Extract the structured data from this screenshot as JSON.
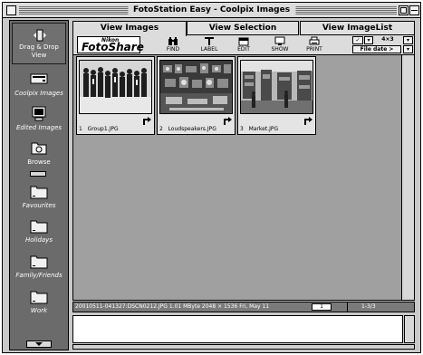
{
  "window": {
    "title": "FotoStation Easy - Coolpix Images"
  },
  "sidebar": {
    "drag_drop_label": "Drag & Drop View",
    "items": [
      {
        "label": "Coolpix Images",
        "icon": "hard-drive-icon"
      },
      {
        "label": "Edited Images",
        "icon": "monitor-icon"
      },
      {
        "label": "Browse",
        "icon": "browse-folder-icon"
      },
      {
        "label": "Favourites",
        "icon": "folder-icon"
      },
      {
        "label": "Holidays",
        "icon": "folder-icon"
      },
      {
        "label": "Family/Friends",
        "icon": "folder-icon"
      },
      {
        "label": "Work",
        "icon": "folder-icon"
      }
    ]
  },
  "tabs": [
    {
      "label": "View Images",
      "active": true
    },
    {
      "label": "View Selection",
      "active": false
    },
    {
      "label": "View ImageList",
      "active": false
    }
  ],
  "toolbar": {
    "logo_small": "Nikon",
    "logo_big": "FotoShare",
    "buttons": [
      {
        "label": "FIND",
        "icon": "binoculars-icon"
      },
      {
        "label": "LABEL",
        "icon": "text-icon"
      },
      {
        "label": "EDIT",
        "icon": "edit-icon"
      },
      {
        "label": "SHOW",
        "icon": "monitor-icon"
      },
      {
        "label": "PRINT",
        "icon": "printer-icon"
      }
    ],
    "check_label": "✓",
    "grid_label": "4×3",
    "sort_label": "File date >"
  },
  "thumbnails": [
    {
      "index": "1",
      "filename": "Group1.JPG"
    },
    {
      "index": "2",
      "filename": "Loudspeakers.JPG"
    },
    {
      "index": "3",
      "filename": "Market.JPG"
    }
  ],
  "status": {
    "info": "20010511-041327:DSCN0212.JPG   1.01 MByte  2048 × 1536   Fri, May 11",
    "page": "1",
    "range": "1-3/3"
  },
  "colors": {
    "window_bg": "#c9c9c9",
    "sidebar_bg": "#6b6b6b",
    "grid_bg": "#a0a0a0"
  }
}
